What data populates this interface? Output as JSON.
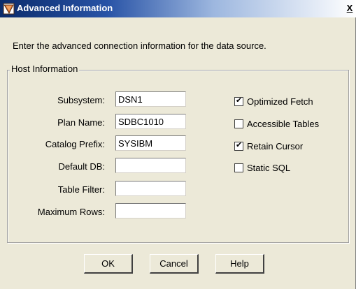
{
  "window": {
    "title": "Advanced Information",
    "close_label": "X"
  },
  "intro_text": "Enter the advanced connection information for the data source.",
  "group": {
    "legend": "Host Information"
  },
  "fields": [
    {
      "label": "Subsystem:",
      "value": "DSN1"
    },
    {
      "label": "Plan Name:",
      "value": "SDBC1010"
    },
    {
      "label": "Catalog Prefix:",
      "value": "SYSIBM"
    },
    {
      "label": "Default DB:",
      "value": ""
    },
    {
      "label": "Table Filter:",
      "value": ""
    },
    {
      "label": "Maximum Rows:",
      "value": ""
    }
  ],
  "checkboxes": [
    {
      "label": "Optimized Fetch",
      "checked": true
    },
    {
      "label": "Accessible Tables",
      "checked": false
    },
    {
      "label": "Retain Cursor",
      "checked": true
    },
    {
      "label": "Static SQL",
      "checked": false
    }
  ],
  "buttons": {
    "ok": {
      "first": "O",
      "rest": "K"
    },
    "cancel": {
      "first": "C",
      "rest": "ancel"
    },
    "help": {
      "first": "H",
      "rest": "elp"
    }
  },
  "colors": {
    "titlebar_start": "#0a2b6b",
    "dialog_bg": "#ece9d8"
  }
}
